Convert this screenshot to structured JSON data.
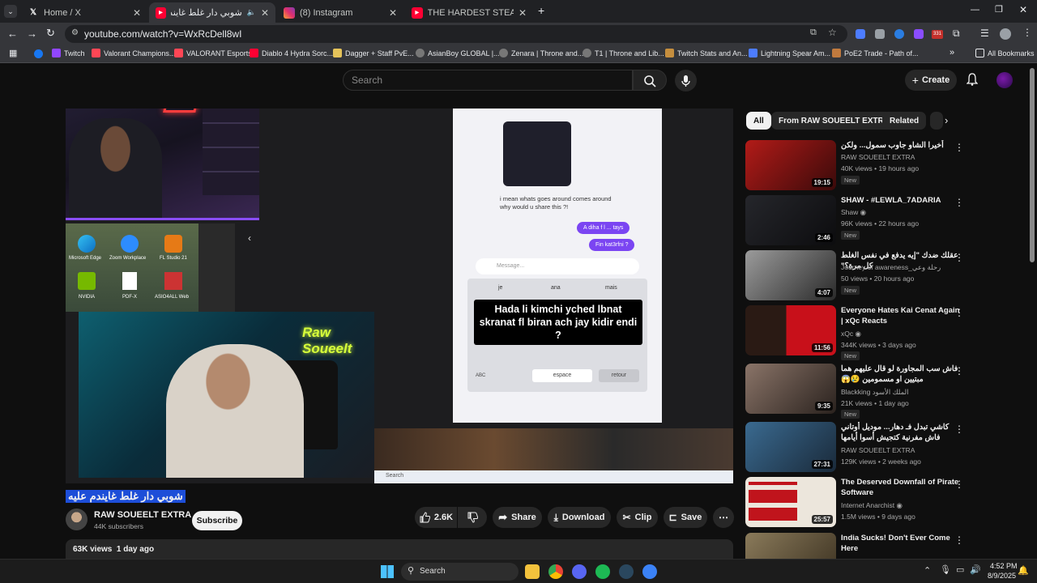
{
  "browser": {
    "tabs": [
      {
        "title": "Home / X",
        "icon": "x-logo-icon"
      },
      {
        "title": "شوبي دار غلط غايندم عليه -",
        "icon": "youtube-icon"
      },
      {
        "title": "(8) Instagram",
        "icon": "instagram-icon"
      },
      {
        "title": "THE HARDEST STEAK CHALLEN",
        "icon": "youtube-icon"
      }
    ],
    "url": "youtube.com/watch?v=WxRcDell8wI",
    "bookmarks": [
      "Twitch",
      "Valorant Champions...",
      "VALORANT Esports",
      "Diablo 4 Hydra Sorc...",
      "Dagger + Staff PvE...",
      "AsianBoy GLOBAL |...",
      "Zenara | Throne and...",
      "T1 | Throne and Lib...",
      "Twitch Stats and An...",
      "Lightning Spear Am...",
      "PoE2 Trade - Path of..."
    ],
    "all_bookmarks": "All Bookmarks",
    "ext_badge": "331"
  },
  "youtube": {
    "search_placeholder": "Search",
    "create_label": "Create",
    "video_title": "شوبي دار غلط غايندم عليه",
    "channel": {
      "name": "RAW SOUEELT EXTRA",
      "subs": "44K subscribers"
    },
    "subscribe_label": "Subscribe",
    "likes": "2.6K",
    "share_label": "Share",
    "download_label": "Download",
    "clip_label": "Clip",
    "save_label": "Save",
    "views_line": "63K views  1 day ago",
    "overlay": {
      "chat_msg": "i mean whats goes around comes around why would u share this ?!",
      "bubble1": "A diha f l ... tays",
      "bubble2": "Fin kat3rfni ?",
      "message_placeholder": "Message...",
      "suggestions": [
        "je",
        "ana",
        "mais"
      ],
      "caption": "Hada li kimchi yched lbnat skranat fl biran ach jay kidir endi ?",
      "space": "espace",
      "return": "retour",
      "abc": "ABC",
      "desktop_icons": [
        "Microsoft Edge",
        "Zoom Workplace",
        "FL Studio 21",
        "NVIDIA",
        "PDF-X",
        "ASIO4ALL Web"
      ],
      "neon_brand": "Raw Soueelt",
      "taskbar_search": "Search"
    },
    "chips": [
      "All",
      "From RAW SOUEELT EXTRA",
      "Related"
    ],
    "recommendations": [
      {
        "title": "أخيرا الشاو جاوب سمول... ولكن",
        "channel": "RAW SOUEELT EXTRA",
        "meta": "40K views • 19 hours ago",
        "badge": "New",
        "duration": "19:15",
        "thumb_color": "#7a1512"
      },
      {
        "title": "SHAW - #LEWLA_7ADARIA",
        "channel": "Shaw",
        "meta": "96K views • 22 hours ago",
        "badge": "New",
        "duration": "2:46",
        "thumb_color": "#1b1c1f"
      },
      {
        "title": "عقلك ضدك \"إيه يدفع في نفس الغلط كل مرة؟\"",
        "channel": "Journey of awareness_رحلة وعي",
        "meta": "50 views • 20 hours ago",
        "badge": "New",
        "duration": "4:07",
        "thumb_color": "#3a3a3a"
      },
      {
        "title": "Everyone Hates Kai Cenat Again | xQc Reacts",
        "channel": "xQc",
        "meta": "344K views • 3 days ago",
        "badge": "New",
        "duration": "11:56",
        "thumb_color": "#b0121a"
      },
      {
        "title": "فاش سب المجاورة لو قال عليهم هما مبتيين او مسمومين 😢😱",
        "channel": "Blackking الملك الأسود",
        "meta": "21K views • 1 day ago",
        "badge": "New",
        "duration": "9:35",
        "thumb_color": "#5a4a44"
      },
      {
        "title": "كاشي تبدل فـ دهار... موديل أوتاني فاش مفرنية كتجيش أسوا أيامها",
        "channel": "RAW SOUEELT EXTRA",
        "meta": "129K views • 2 weeks ago",
        "badge": "",
        "duration": "27:31",
        "thumb_color": "#2e4f6b"
      },
      {
        "title": "The Deserved Downfall of Pirate Software",
        "channel": "Internet Anarchist",
        "meta": "1.5M views • 9 days ago",
        "badge": "",
        "duration": "25:57",
        "thumb_color": "#e8e2d8"
      },
      {
        "title": "India Sucks! Don't Ever Come Here",
        "channel": "",
        "meta": "",
        "badge": "",
        "duration": "",
        "thumb_color": "#6a5a40"
      }
    ]
  },
  "taskbar": {
    "search": "Search",
    "time": "4:52 PM",
    "date": "8/9/2025"
  },
  "colors": {
    "youtube_red": "#ff0033",
    "accent_purple": "#8a4dff",
    "neon_yellow": "#d7ff3a"
  }
}
